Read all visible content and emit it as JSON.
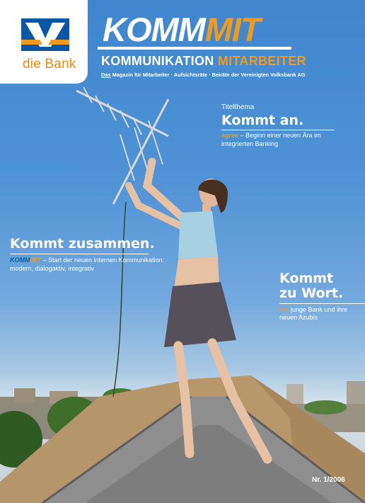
{
  "brand": {
    "logo_text": "die Bank",
    "colors": {
      "blue": "#0a57a6",
      "orange": "#f29a1b",
      "white": "#ffffff"
    }
  },
  "masthead": {
    "title_part1": "KOMM",
    "title_part2": "MIT",
    "subtitle_part1": "KOMMUNIKATION",
    "subtitle_part2": "MITARBEITER",
    "desc_lead": "Das",
    "desc_rest": " Magazin für Mitarbeiter · Aufsichtsräte · Beiräte der Vereinigten Volksbank AG"
  },
  "stories": {
    "top": {
      "kicker": "Titelthema",
      "headline": "Kommt an.",
      "brand_word": "agree",
      "teaser_rest": " – Beginn einer neuen Ära im integrierten Banking"
    },
    "left": {
      "headline": "Kommt zusammen.",
      "brand_part1": "KOMM",
      "brand_part2": "MIT",
      "teaser_rest": " – Start der neuen internen Kommunikation: modern, dialogaktiv, integrativ"
    },
    "right": {
      "headline_line1": "Kommt",
      "headline_line2": "zu Wort.",
      "brand_word": "Die",
      "teaser_rest": " junge Bank und ihre neuen Azubis"
    }
  },
  "issue": {
    "label": "Nr. 1/2006"
  }
}
